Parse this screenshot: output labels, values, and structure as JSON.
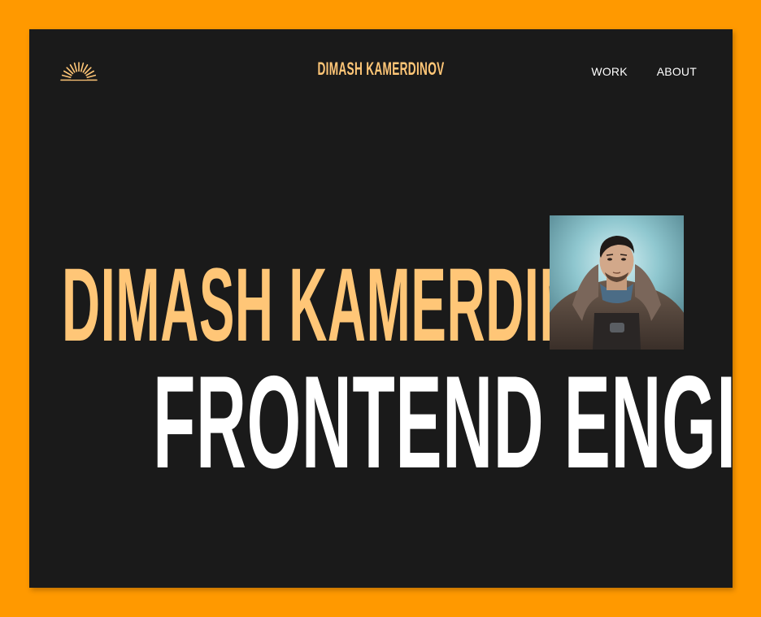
{
  "header": {
    "brand": "DIMASH KAMERDINOV",
    "logo_icon": "sunrise-icon",
    "nav": [
      {
        "label": "WORK"
      },
      {
        "label": "ABOUT"
      }
    ]
  },
  "hero": {
    "name": "DIMASH KAMERDINOV",
    "role": "FRONTEND ENGINEER",
    "avatar_icon": "portrait-photo"
  },
  "colors": {
    "page_bg": "#ff9900",
    "panel_bg": "#1a1a1a",
    "accent": "#ffc677",
    "text": "#ffffff"
  }
}
